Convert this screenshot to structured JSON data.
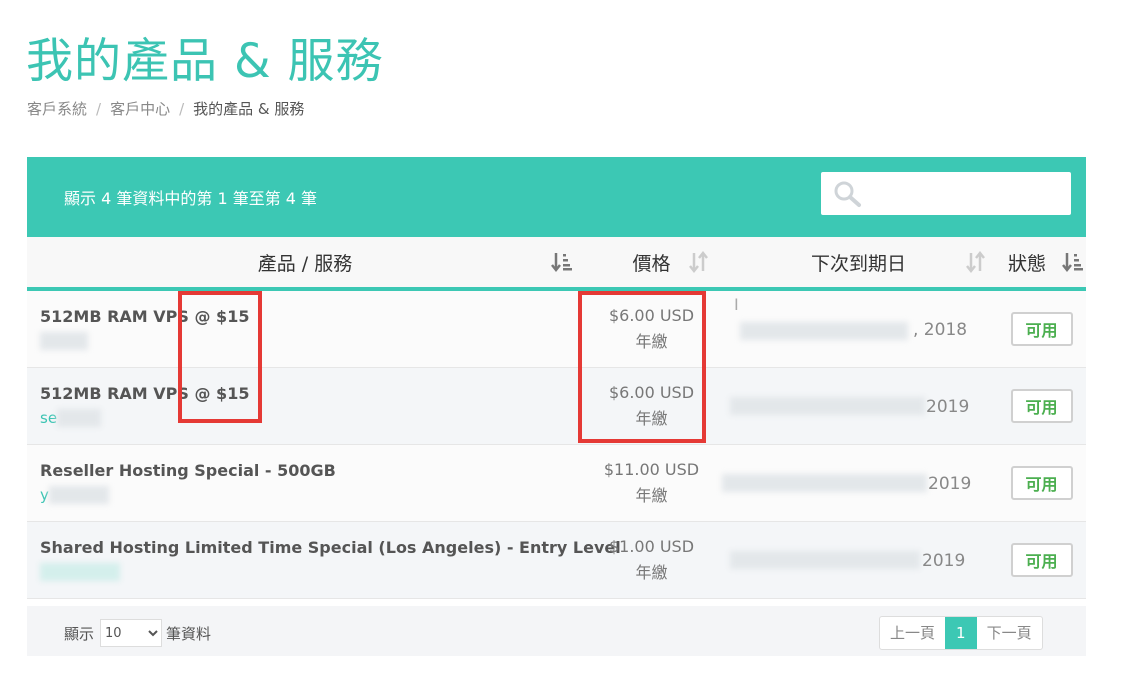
{
  "page": {
    "title": "我的產品 & 服務",
    "breadcrumb": [
      "客戶系統",
      "客戶中心",
      "我的產品 & 服務"
    ]
  },
  "toolbar": {
    "info": "顯示 4 筆資料中的第 1 筆至第 4 筆",
    "search_placeholder": "",
    "search_icon": "search-icon"
  },
  "table": {
    "headers": [
      "產品 / 服務",
      "價格",
      "下次到期日",
      "狀態"
    ],
    "rows": [
      {
        "product": "512MB RAM VPS @ $15",
        "domain": "",
        "price": "$6.00 USD",
        "cycle": "年繳",
        "date": ", 2018",
        "status": "可用"
      },
      {
        "product": "512MB RAM VPS @ $15",
        "domain": "se",
        "price": "$6.00 USD",
        "cycle": "年繳",
        "date": "2019",
        "status": "可用"
      },
      {
        "product": "Reseller Hosting Special - 500GB",
        "domain": "y",
        "price": "$11.00 USD",
        "cycle": "年繳",
        "date": "2019",
        "status": "可用"
      },
      {
        "product": "Shared Hosting Limited Time Special (Los Angeles) - Entry Level",
        "domain": "",
        "price": "$1.00 USD",
        "cycle": "年繳",
        "date": "2019",
        "status": "可用"
      }
    ]
  },
  "footer": {
    "show_label": "顯示",
    "page_size": "10",
    "records_label": "筆資料",
    "prev": "上一頁",
    "current_page": "1",
    "next": "下一頁"
  },
  "colors": {
    "accent": "#3cc8b4",
    "status_green": "#4caf50",
    "highlight_red": "#e53935"
  }
}
